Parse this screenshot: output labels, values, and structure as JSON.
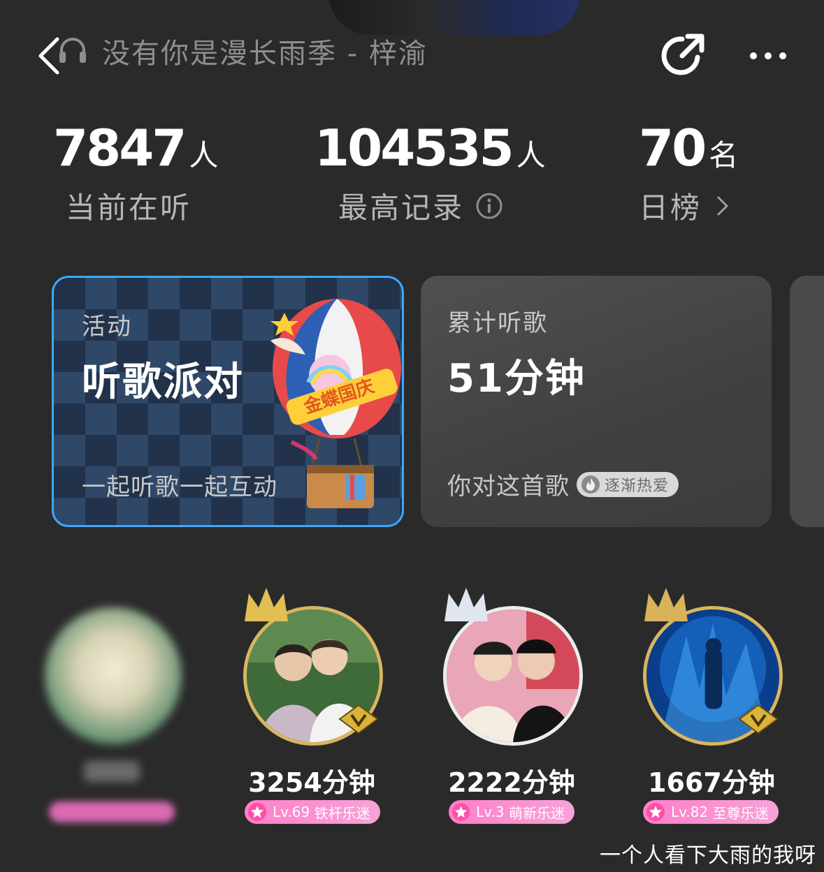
{
  "header": {
    "title": "没有你是漫长雨季 - 梓渝",
    "back_icon": "chevron-left-icon",
    "headphone_icon": "headphone-icon",
    "share_icon": "share-icon",
    "more_icon": "more-dots-icon"
  },
  "stats": [
    {
      "value": "7847",
      "unit": "人",
      "label": "当前在听"
    },
    {
      "value": "104535",
      "unit": "人",
      "label": "最高记录",
      "icon": "info-icon"
    },
    {
      "value": "70",
      "unit": "名",
      "label": "日榜",
      "icon": "chevron-right-icon"
    }
  ],
  "cards": {
    "activity": {
      "kicker": "活动",
      "title": "听歌派对",
      "subtitle": "一起听歌一起互动",
      "art_text": "金蝶国庆",
      "accent": "#3ea7ff"
    },
    "listening": {
      "kicker": "累计听歌",
      "title": "51分钟",
      "subtitle": "你对这首歌",
      "badge": "逐渐热爱"
    }
  },
  "ranking": [
    {
      "minutes": "3254分钟",
      "level": "Lv.69",
      "level_title": "铁杆乐迷"
    },
    {
      "minutes": "2222分钟",
      "level": "Lv.3",
      "level_title": "萌新乐迷"
    },
    {
      "minutes": "1667分钟",
      "level": "Lv.82",
      "level_title": "至尊乐迷"
    }
  ],
  "watermark": "一个人看下大雨的我呀",
  "colors": {
    "background": "#2a2a2b",
    "badge_pink": "#ff7fc9",
    "gold_ring": "#d8b660"
  }
}
